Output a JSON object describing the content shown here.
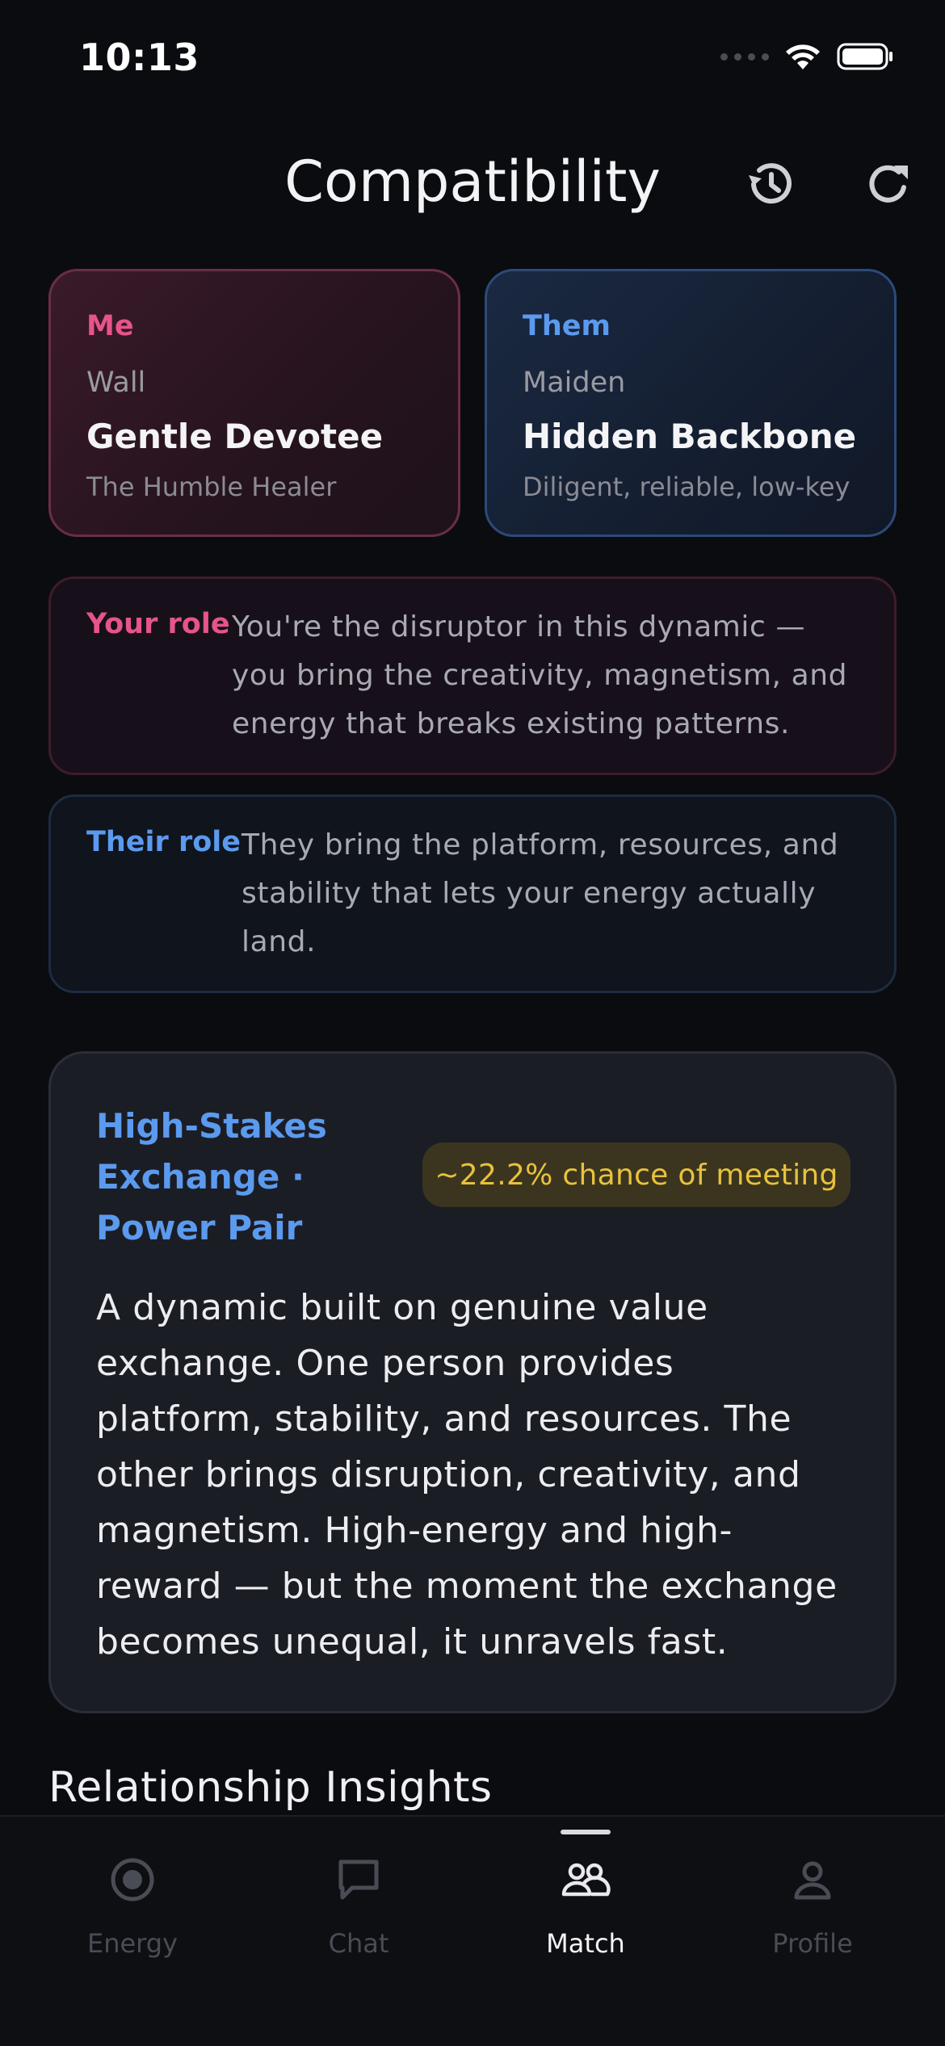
{
  "status_bar": {
    "time": "10:13"
  },
  "header": {
    "title": "Compatibility"
  },
  "me_card": {
    "label": "Me",
    "subtitle": "Wall",
    "name": "Gentle Devotee",
    "description": "The Humble Healer"
  },
  "them_card": {
    "label": "Them",
    "subtitle": "Maiden",
    "name": "Hidden Backbone",
    "description": "Diligent, reliable, low-key"
  },
  "your_role": {
    "label": "Your role",
    "text": "You're the disruptor in this dynamic — you bring the creativity, magnetism, and energy that breaks existing patterns."
  },
  "their_role": {
    "label": "Their role",
    "text": "They bring the platform, resources, and stability that lets your energy actually land."
  },
  "dynamic": {
    "title": "High-Stakes Exchange · Power Pair",
    "chance": "~22.2% chance of meeting",
    "body": "A dynamic built on genuine value exchange. One person provides platform, stability, and resources. The other brings disruption, creativity, and magnetism. High-energy and high-reward — but the moment the exchange becomes unequal, it unravels fast."
  },
  "insights": {
    "title": "Relationship Insights"
  },
  "tabs": [
    {
      "label": "Energy",
      "icon": "energy-icon"
    },
    {
      "label": "Chat",
      "icon": "chat-icon"
    },
    {
      "label": "Match",
      "icon": "match-icon",
      "active": true
    },
    {
      "label": "Profile",
      "icon": "profile-icon"
    }
  ],
  "colors": {
    "background": "#0b0c10",
    "me_accent": "#e5548a",
    "them_accent": "#5b9aee",
    "chance_text": "#e8c23c"
  }
}
